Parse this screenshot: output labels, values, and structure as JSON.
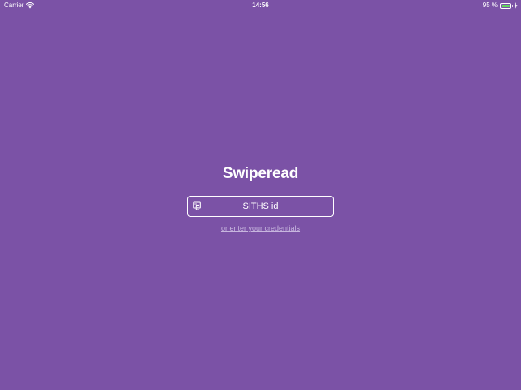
{
  "status_bar": {
    "carrier": "Carrier",
    "time": "14:56",
    "battery_percent": "95 %",
    "battery_level": 0.95,
    "battery_color": "#62d561",
    "icons": [
      "wifi-icon",
      "battery-icon",
      "charging-icon"
    ]
  },
  "app": {
    "title": "Swiperead",
    "background_color": "#7b52a6"
  },
  "login": {
    "siths_button_label": "SITHS id",
    "siths_button_icon": "card-reader-icon",
    "credentials_link_text": "or enter your credentials"
  }
}
